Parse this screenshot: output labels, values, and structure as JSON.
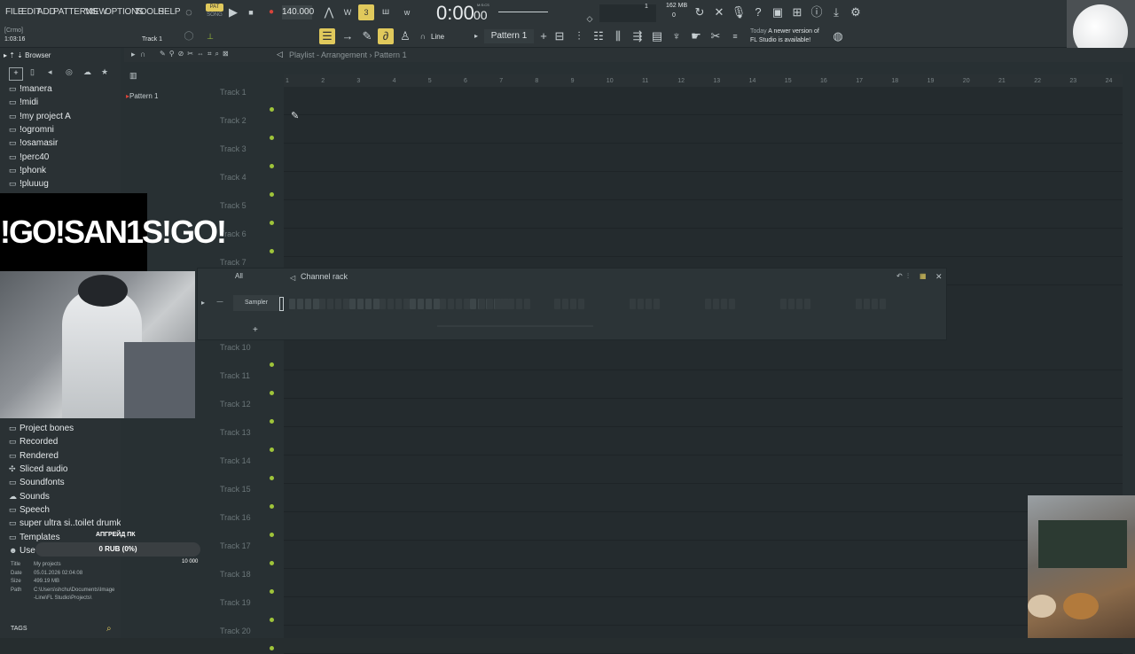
{
  "menu": [
    "FILE",
    "EDIT",
    "ADD",
    "PATTERNS",
    "VIEW",
    "OPTIONS",
    "TOOLS",
    "HELP"
  ],
  "transport": {
    "mode_top": "PAT",
    "mode_bottom": "SONG",
    "tempo": "140.000",
    "time": "0:00",
    "time_small": "00",
    "time_unit": "M:S:CS",
    "cpu": "1",
    "mem": "162 MB",
    "polyphony": "0"
  },
  "hint": {
    "title": "[Crmo]",
    "time": "1:03:16",
    "track": "Track 1"
  },
  "toolbar2": {
    "snap_label": "Line",
    "pattern_label": "Pattern 1"
  },
  "news": {
    "day": "Today",
    "line1": "A newer version of",
    "line2": "FL Studio is available!"
  },
  "browser": {
    "title": "Browser",
    "top_items": [
      "!manera",
      "!midi",
      "!my project A",
      "!ogromni",
      "!osamasir",
      "!perc40",
      "!phonk",
      "!pluuug"
    ],
    "bottom_items": [
      "Project bones",
      "Recorded",
      "Rendered",
      "Sliced audio",
      "Soundfonts",
      "Sounds",
      "Speech",
      "super ultra si..toilet drumkit",
      "Templates",
      "Use"
    ],
    "bottom_icons": [
      "folder-icon",
      "folder-icon",
      "folder-icon",
      "sliced-audio-icon",
      "folder-icon",
      "cloud-icon",
      "folder-icon",
      "folder-icon",
      "folder-icon",
      "user-icon"
    ],
    "info": {
      "title_label": "Title",
      "title_value": "My projects",
      "date_label": "Date",
      "date_value": "05.01.2026 02:04:08",
      "size_label": "Size",
      "size_value": "499.19 MB",
      "path_label": "Path",
      "path_value": "C:\\Users\\shchu\\Documents\\Image-Line\\FL Studio\\Projects\\"
    },
    "tags_label": "TAGS"
  },
  "playlist": {
    "title": "Playlist - Arrangement",
    "pattern": "Pattern 1",
    "pattern_list": [
      "Pattern 1"
    ],
    "ruler": [
      "1",
      "2",
      "3",
      "4",
      "5",
      "6",
      "7",
      "8",
      "9",
      "10",
      "11",
      "12",
      "13",
      "14",
      "15",
      "16",
      "17",
      "18",
      "19",
      "20",
      "21",
      "22",
      "23",
      "24"
    ],
    "tracks_top": [
      "Track 1",
      "Track 2",
      "Track 3",
      "Track 4",
      "Track 5",
      "Track 6",
      "Track 7"
    ],
    "tracks_bottom": [
      "Track 10",
      "Track 11",
      "Track 12",
      "Track 13",
      "Track 14",
      "Track 15",
      "Track 16",
      "Track 17",
      "Track 18",
      "Track 19",
      "Track 20"
    ]
  },
  "channel_rack": {
    "title": "Channel rack",
    "filter": "All",
    "channel_name": "Sampler",
    "add_label": "+"
  },
  "stream": {
    "logo": "!GO!SAN1S!GO!",
    "donation_label": "АПГРЕЙД ПК",
    "donation_value": "0 RUB (0%)",
    "donation_goal": "10 000"
  },
  "colors": {
    "accent_yellow": "#e0c95c",
    "track_dot_green": "#9fc43a",
    "record_red": "#d8443a",
    "background": "#262d2f"
  }
}
